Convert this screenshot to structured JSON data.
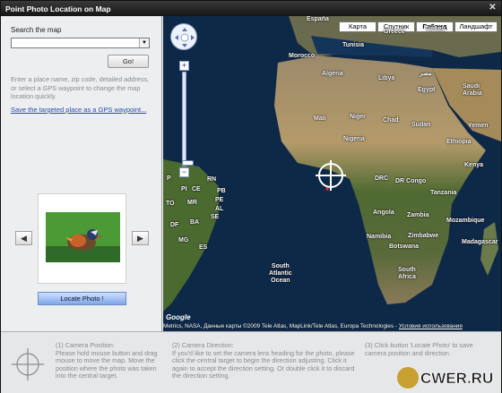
{
  "window": {
    "title": "Point Photo Location on Map",
    "close_glyph": "✕"
  },
  "sidebar": {
    "search_label": "Search the map",
    "search_value": "",
    "dropdown_glyph": "▼",
    "go_label": "Go!",
    "hint": "Enter a place name, zip code, detailed address, or select a GPS waypoint to change the map location quickly.",
    "save_link": "Save the targeted place as a GPS waypoint...",
    "prev_glyph": "◀",
    "next_glyph": "▶",
    "locate_label": "Locate Photo !"
  },
  "map": {
    "types": [
      {
        "label": "Карта",
        "active": false
      },
      {
        "label": "Спутник",
        "active": false
      },
      {
        "label": "Гибрид",
        "active": true
      },
      {
        "label": "Ландшафт",
        "active": false
      }
    ],
    "zoom_in": "+",
    "zoom_out": "−",
    "labels": {
      "espana": "España",
      "tunisia": "Tunisia",
      "greece": "Greece",
      "turkey": "Turkey",
      "morocco": "Morocco",
      "algeria": "Algeria",
      "libya": "Libya",
      "egypt": "Egypt",
      "saudi": "Saudi\nArabia",
      "mali": "Mali",
      "niger": "Niger",
      "chad": "Chad",
      "sudan": "Sudan",
      "yemen": "Yemen",
      "nigeria": "Nigeria",
      "ethiopia": "Ethiopia",
      "drc": "DRC",
      "congo": "DR Congo",
      "kenya": "Kenya",
      "tanzania": "Tanzania",
      "angola": "Angola",
      "zambia": "Zambia",
      "mozambique": "Mozambique",
      "namibia": "Namibia",
      "zimbabwe": "Zimbabwe",
      "botswana": "Botswana",
      "madagascar": "Madagascar",
      "south_africa": "South\nAfrica",
      "south_atlantic": "South\nAtlantic\nOcean",
      "rn": "RN",
      "pb": "PB",
      "pe": "PE",
      "al": "AL",
      "se": "SE",
      "ce": "CE",
      "pi": "PI",
      "to": "TO",
      "ba": "BA",
      "mg": "MG",
      "es": "ES",
      "df": "DF",
      "mr": "MR",
      "brazil_p": "P",
      "arabic": "مصر"
    },
    "powered_by": "Google",
    "attribution": "Metrics, NASA, Данные карты ©2009 Tele Atlas, MapLink/Tele Atlas, Europa Technologies - ",
    "terms_link": "Условия использования"
  },
  "bottom": {
    "step1_title": "(1) Camera Position:",
    "step1_text": "Please hold mouse button and drag mouse to move the map. Move the position where the photo was taken into the central target.",
    "step2_title": "(2) Camera Direction:",
    "step2_text": "If you'd like to set the camera lens heading for the photo, please click the central target to begin the direction adjusting. Click it again to accept the direction setting. Or double click it to discard the direction setting.",
    "step3_title": "(3) Click button 'Locate Photo' to save camera position and direction.",
    "watermark": "CWER.RU"
  },
  "colors": {
    "ocean": "#0e2948",
    "sahara": "#b59a6a",
    "forest": "#3e5a2a",
    "accent_link": "#2a4aa8"
  }
}
